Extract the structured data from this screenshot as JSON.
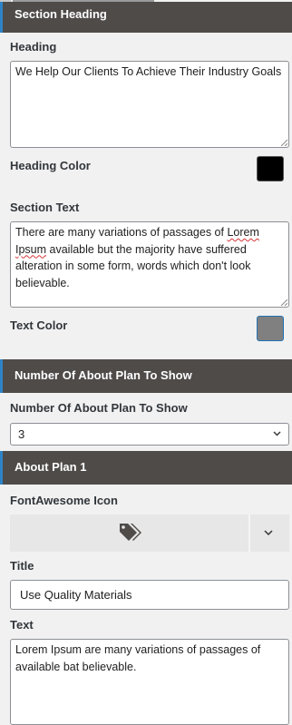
{
  "section_heading": {
    "header": "Section Heading"
  },
  "heading": {
    "label": "Heading",
    "value": "We Help Our Clients To Achieve Their Industry Goals"
  },
  "heading_color": {
    "label": "Heading Color",
    "color": "#000000"
  },
  "section_text": {
    "label": "Section Text",
    "value_parts": [
      "There are many variations of passages of ",
      "Lorem",
      " ",
      "Ipsum",
      " available but the majority have suffered alteration in some form, words which don't look believable."
    ]
  },
  "text_color": {
    "label": "Text Color",
    "color": "#808080"
  },
  "plans_count": {
    "header": "Number Of About Plan To Show",
    "label": "Number Of About Plan To Show",
    "selected": "3"
  },
  "about_plan_1": {
    "header": "About Plan 1",
    "icon_label": "FontAwesome Icon",
    "icon_name": "tags-icon",
    "title_label": "Title",
    "title_value": "Use Quality Materials",
    "text_label": "Text",
    "text_value": "Lorem Ipsum are many variations of passages of available bat believable."
  },
  "colors": {
    "header_bg": "#4f4b49",
    "accent": "#2e83c7"
  }
}
